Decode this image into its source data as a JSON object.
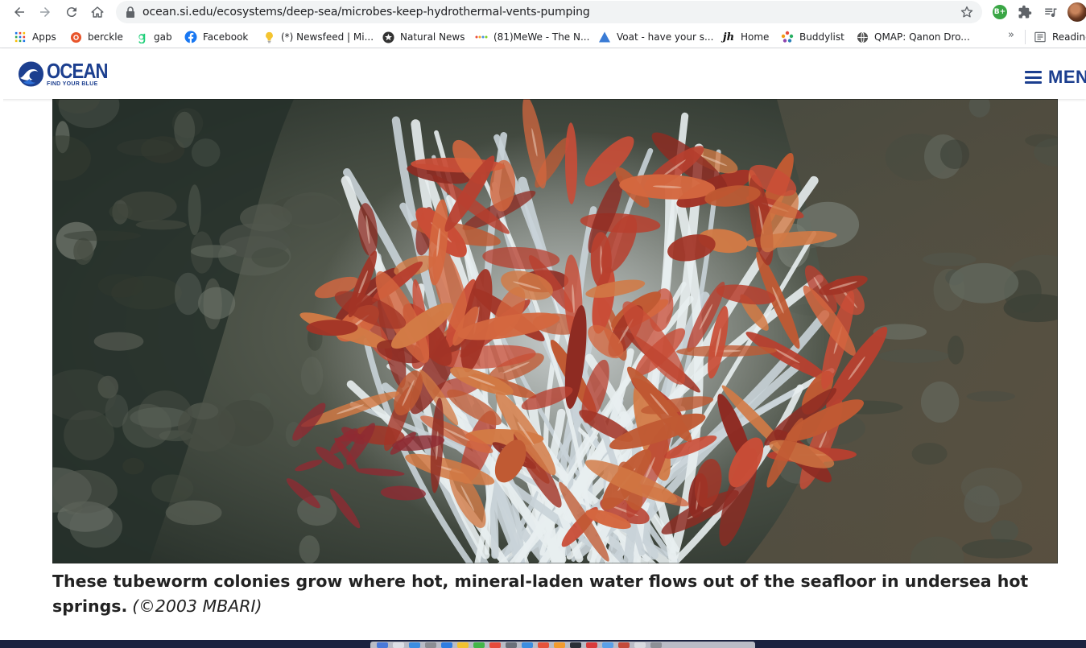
{
  "browser": {
    "url": "ocean.si.edu/ecosystems/deep-sea/microbes-keep-hydrothermal-vents-pumping",
    "bookmarks": [
      {
        "label": "Apps",
        "icon": "apps-grid-icon"
      },
      {
        "label": "berckle",
        "icon": "berckle-icon"
      },
      {
        "label": "gab",
        "icon": "gab-icon"
      },
      {
        "label": "Facebook",
        "icon": "facebook-icon"
      },
      {
        "label": "(*) Newsfeed | Mi...",
        "icon": "lightbulb-icon"
      },
      {
        "label": "Natural News",
        "icon": "natural-news-icon"
      },
      {
        "label": "(81)MeWe - The N...",
        "icon": "mewe-icon"
      },
      {
        "label": "Voat - have your s...",
        "icon": "voat-icon"
      },
      {
        "label": "Home",
        "icon": "jh-icon"
      },
      {
        "label": "Buddylist",
        "icon": "buddylist-icon"
      },
      {
        "label": "QMAP: Qanon Dro...",
        "icon": "globe-icon"
      },
      {
        "label": "Reading",
        "icon": "reading-list-icon"
      }
    ],
    "more_bookmarks": "»",
    "extension_badge": "B+"
  },
  "site": {
    "logo_word": "OCEAN",
    "logo_tagline": "FIND YOUR BLUE",
    "menu_label": "MENU"
  },
  "article": {
    "caption": "These tubeworm colonies grow where hot, mineral-laden water flows out of the seafloor in undersea hot springs.",
    "credit": "(©2003 MBARI)"
  },
  "colors": {
    "brand": "#1c3f8f",
    "worm_plume": "#c0392b",
    "tube_white": "#e8eef0",
    "seafloor": "#3a4238"
  }
}
